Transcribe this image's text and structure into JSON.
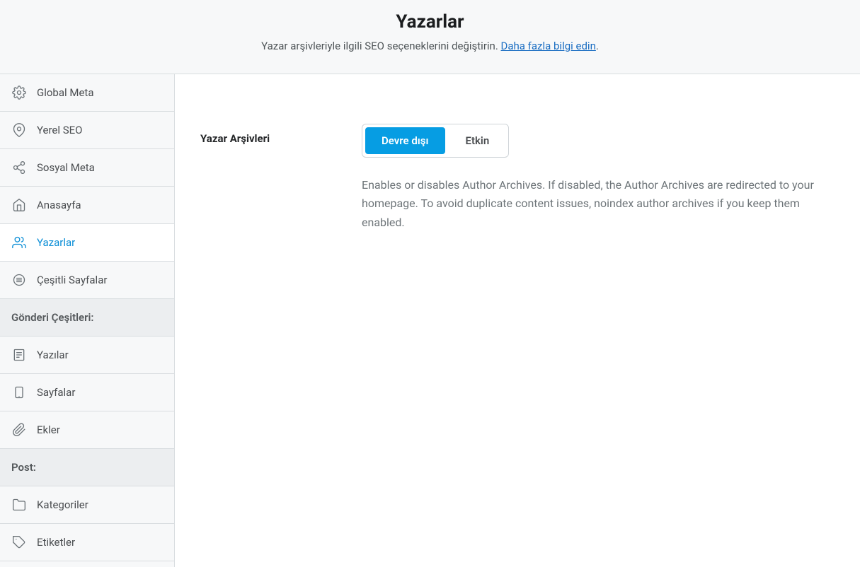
{
  "header": {
    "title": "Yazarlar",
    "subtitle_text": "Yazar arşivleriyle ilgili SEO seçeneklerini değiştirin. ",
    "learn_more_label": "Daha fazla bilgi edin",
    "period": "."
  },
  "sidebar": {
    "items": [
      {
        "key": "global-meta",
        "label": "Global Meta",
        "icon": "gear"
      },
      {
        "key": "yerel-seo",
        "label": "Yerel SEO",
        "icon": "pin"
      },
      {
        "key": "sosyal-meta",
        "label": "Sosyal Meta",
        "icon": "share"
      },
      {
        "key": "anasayfa",
        "label": "Anasayfa",
        "icon": "home"
      },
      {
        "key": "yazarlar",
        "label": "Yazarlar",
        "icon": "users",
        "active": true
      },
      {
        "key": "cesitli",
        "label": "Çeşitli Sayfalar",
        "icon": "text-lines"
      }
    ],
    "section_post_types_label": "Gönderi Çeşitleri:",
    "post_types": [
      {
        "key": "yazilar",
        "label": "Yazılar",
        "icon": "post"
      },
      {
        "key": "sayfalar",
        "label": "Sayfalar",
        "icon": "page"
      },
      {
        "key": "ekler",
        "label": "Ekler",
        "icon": "clip"
      }
    ],
    "section_post_label": "Post:",
    "taxonomies": [
      {
        "key": "kategoriler",
        "label": "Kategoriler",
        "icon": "folder"
      },
      {
        "key": "etiketler",
        "label": "Etiketler",
        "icon": "tag"
      }
    ]
  },
  "main": {
    "author_archives_label": "Yazar Arşivleri",
    "toggle": {
      "disabled_label": "Devre dışı",
      "enabled_label": "Etkin"
    },
    "description": "Enables or disables Author Archives. If disabled, the Author Archives are redirected to your homepage. To avoid duplicate content issues, noindex author archives if you keep them enabled."
  }
}
